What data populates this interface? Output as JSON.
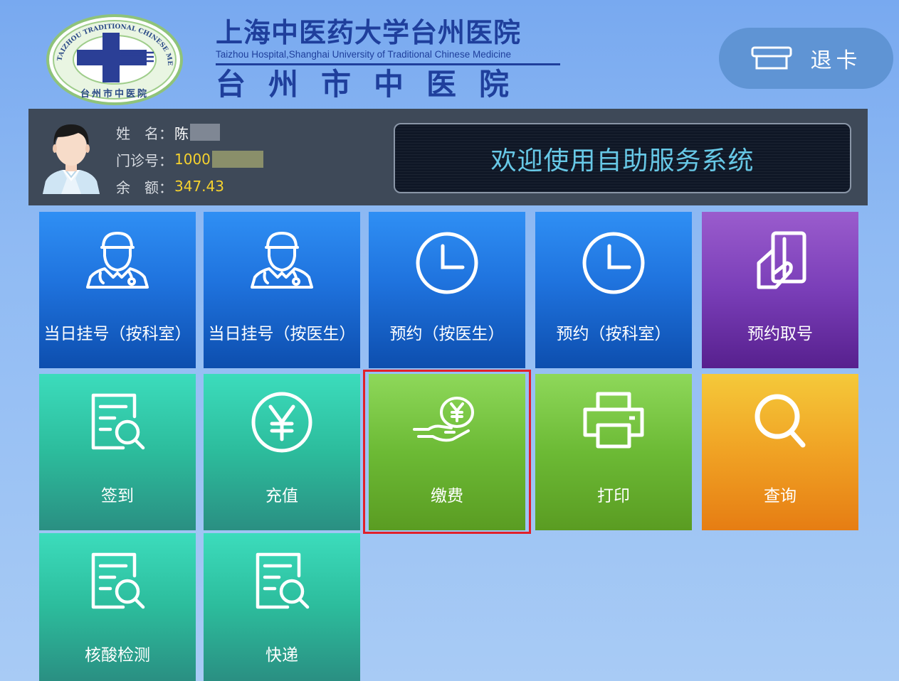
{
  "header": {
    "hospital_name_cn": "上海中医药大学台州医院",
    "hospital_name_en": "Taizhou Hospital,Shanghai University of Traditional Chinese Medicine",
    "hospital_name_local": "台州市中医院",
    "logo_ring_text": "TAIZHOU TRADITIONAL CHINESE MEDICINE HOSPITAL",
    "logo_bottom_text": "台州市中医院",
    "exit_button_label": "退卡"
  },
  "patient": {
    "name_label": "姓　名：",
    "name_value": "陈",
    "clinic_no_label": "门诊号：",
    "clinic_no_value": "1000",
    "balance_label": "余　额：",
    "balance_value": "347.43"
  },
  "welcome_text": "欢迎使用自助服务系统",
  "tiles": [
    {
      "label": "当日挂号（按科室）",
      "icon": "doctor-icon"
    },
    {
      "label": "当日挂号（按医生）",
      "icon": "doctor-icon"
    },
    {
      "label": "预约（按医生）",
      "icon": "clock-icon"
    },
    {
      "label": "预约（按科室）",
      "icon": "clock-icon"
    },
    {
      "label": "预约取号",
      "icon": "card-hand-icon"
    },
    {
      "label": "签到",
      "icon": "document-search-icon"
    },
    {
      "label": "充值",
      "icon": "yen-circle-icon"
    },
    {
      "label": "缴费",
      "icon": "yen-hand-icon"
    },
    {
      "label": "打印",
      "icon": "printer-icon"
    },
    {
      "label": "查询",
      "icon": "search-icon"
    },
    {
      "label": "核酸检测",
      "icon": "document-search-icon"
    },
    {
      "label": "快递",
      "icon": "document-search-icon"
    }
  ],
  "highlighted_tile": "缴费",
  "colors": {
    "brand_blue": "#1f3f9c",
    "info_bar": "#3e4958",
    "welcome_text": "#67c8e6",
    "balance_yellow": "#f6d22e",
    "highlight_red": "#e0202a"
  }
}
